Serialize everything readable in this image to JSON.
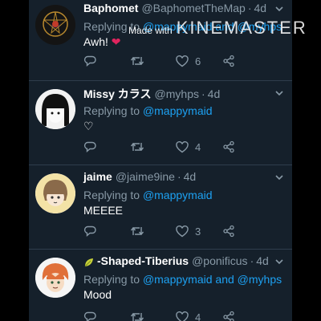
{
  "tweets": [
    {
      "name": "Baphomet",
      "handle": "@BaphometTheMap",
      "dot": "·",
      "time": "4d",
      "reply_prefix": "Replying to",
      "reply_target": "@mappymaid",
      "reply_conj": "and",
      "reply_target2": "@myhps",
      "text": "Awh!",
      "emoji": "❤",
      "retweets": "",
      "likes": "6"
    },
    {
      "name": "Missy カラス",
      "handle": "@myhps",
      "dot": "·",
      "time": "4d",
      "reply_prefix": "Replying to",
      "reply_target": "@mappymaid",
      "text": "♡",
      "retweets": "",
      "likes": "4"
    },
    {
      "name": "jaime",
      "handle": "@jaime9ine",
      "dot": "·",
      "time": "4d",
      "reply_prefix": "Replying to",
      "reply_target": "@mappymaid",
      "text": "MEEEE",
      "retweets": "",
      "likes": "3"
    },
    {
      "name": "-Shaped-Tiberius",
      "handle": "@ponificus",
      "dot": "·",
      "time": "4d",
      "reply_prefix": "Replying to",
      "reply_target": "@mappymaid",
      "reply_conj": "and",
      "reply_target2": "@myhps",
      "text": "Mood",
      "retweets": "",
      "likes": "4"
    }
  ],
  "watermark": {
    "small": "Made with",
    "big": "KINEMASTER"
  },
  "colors": {
    "background": "#15202b",
    "link": "#1da1f2",
    "muted": "#8899a6",
    "heart_emoji": "#e0245e"
  },
  "icons": [
    "reply-icon",
    "retweet-icon",
    "like-icon",
    "share-icon",
    "chevron-down-icon",
    "leaf-emoji-icon"
  ]
}
